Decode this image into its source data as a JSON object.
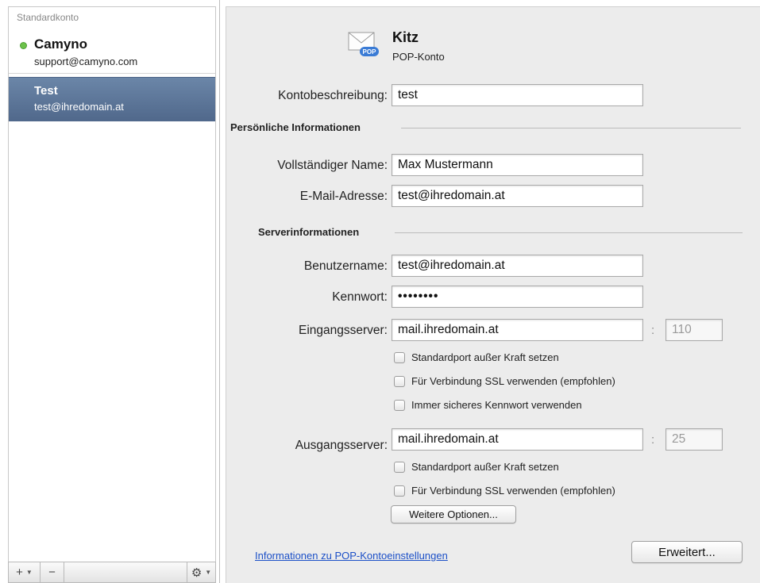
{
  "sidebar": {
    "group_label": "Standardkonto",
    "accounts": [
      {
        "name": "Camyno",
        "email": "support@camyno.com",
        "status_color": "#6cc24a"
      },
      {
        "name": "Test",
        "email": "test@ihredomain.at",
        "selected": true
      }
    ],
    "footer": {
      "add": "+",
      "remove": "−",
      "gear": "⚙"
    }
  },
  "account": {
    "title": "Kitz",
    "type": "POP-Konto",
    "icon": "envelope-pop-icon",
    "icon_badge": "POP"
  },
  "form": {
    "description_label": "Kontobeschreibung:",
    "description_value": "test",
    "personal_section": "Persönliche Informationen",
    "fullname_label": "Vollständiger Name:",
    "fullname_value": "Max Mustermann",
    "email_label": "E-Mail-Adresse:",
    "email_value": "test@ihredomain.at",
    "server_section": "Serverinformationen",
    "username_label": "Benutzername:",
    "username_value": "test@ihredomain.at",
    "password_label": "Kennwort:",
    "password_value": "••••••••",
    "incoming_label": "Eingangsserver:",
    "incoming_value": "mail.ihredomain.at",
    "incoming_port": "110",
    "incoming_options": [
      "Standardport außer Kraft setzen",
      "Für Verbindung SSL verwenden (empfohlen)",
      "Immer sicheres Kennwort verwenden"
    ],
    "outgoing_label": "Ausgangsserver:",
    "outgoing_value": "mail.ihredomain.at",
    "outgoing_port": "25",
    "outgoing_options": [
      "Standardport außer Kraft setzen",
      "Für Verbindung SSL verwenden (empfohlen)"
    ],
    "more_options": "Weitere Optionen...",
    "colon": ":"
  },
  "footer": {
    "info_link": "Informationen zu POP-Kontoeinstellungen",
    "advanced": "Erweitert..."
  }
}
